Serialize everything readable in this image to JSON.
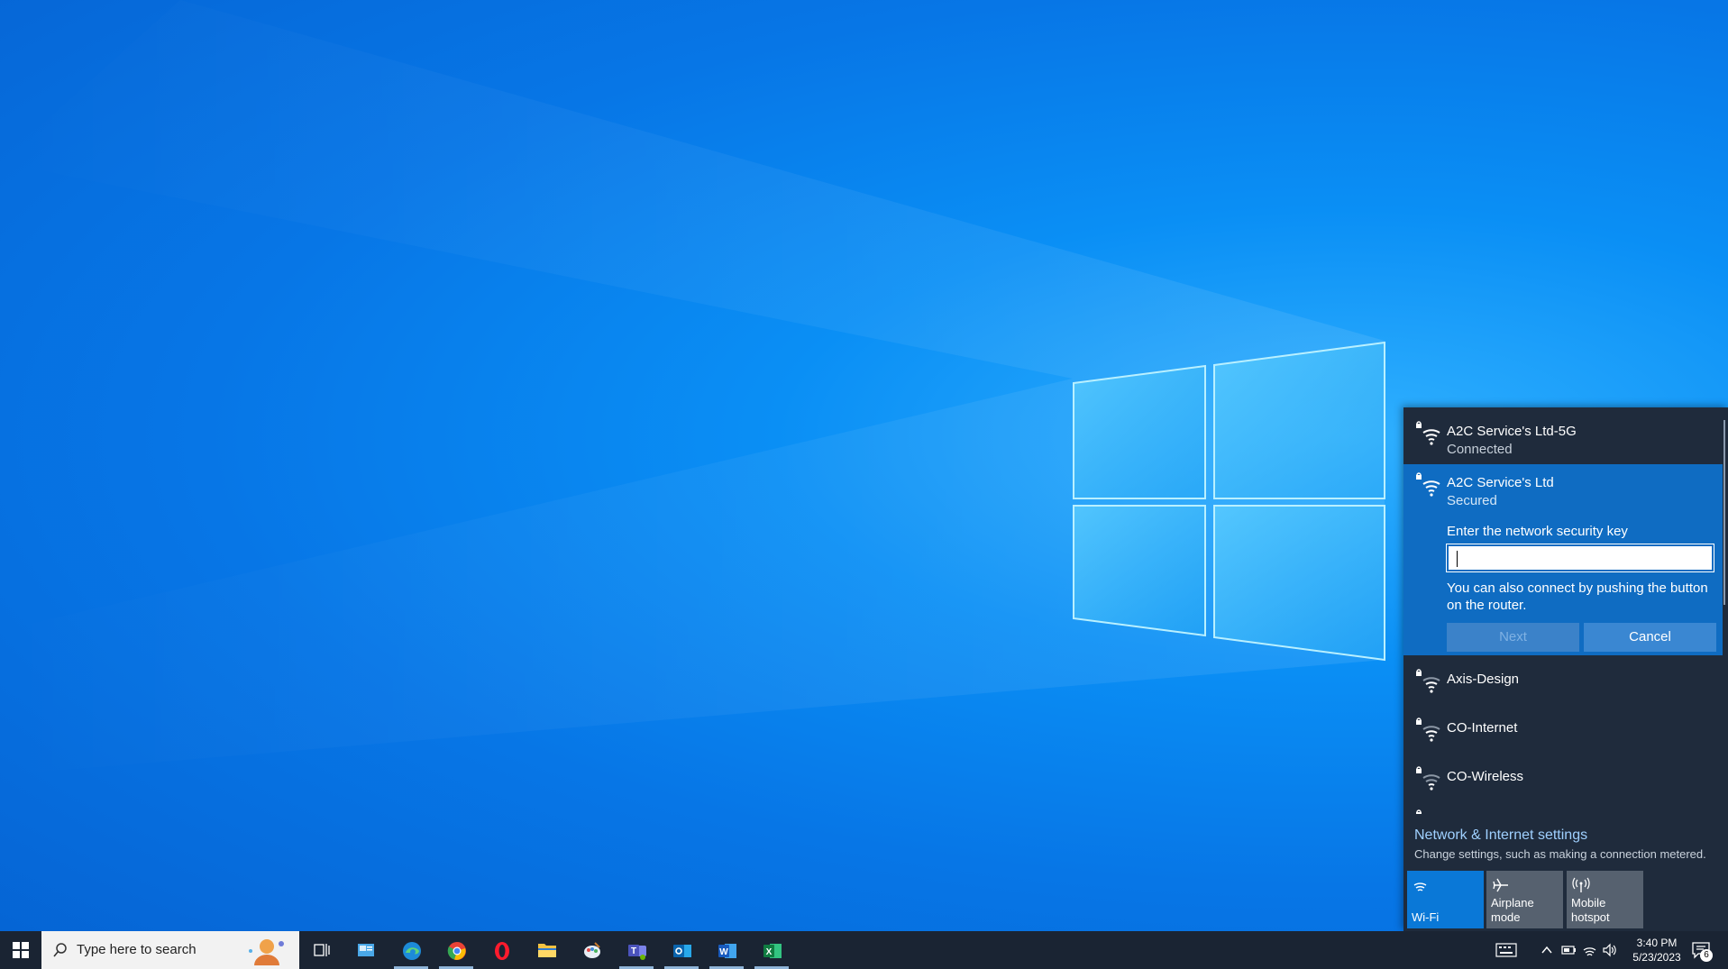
{
  "flyout": {
    "networks_top": [
      {
        "name": "A2C Service's Ltd-5G",
        "status": "Connected"
      }
    ],
    "expanded_network": {
      "name": "A2C Service's Ltd",
      "status": "Secured",
      "key_label": "Enter the network security key",
      "key_value": "",
      "hint": "You can also connect by pushing the button on the router.",
      "next_label": "Next",
      "cancel_label": "Cancel"
    },
    "networks_bottom": [
      {
        "name": "Axis-Design"
      },
      {
        "name": "CO-Internet"
      },
      {
        "name": "CO-Wireless"
      }
    ],
    "settings_title": "Network & Internet settings",
    "settings_subtitle": "Change settings, such as making a connection metered.",
    "quick_actions": [
      {
        "label": "Wi-Fi",
        "icon": "wifi-icon",
        "active": true
      },
      {
        "label": "Airplane mode",
        "icon": "airplane-icon",
        "active": false
      },
      {
        "label": "Mobile hotspot",
        "icon": "hotspot-icon",
        "active": false
      }
    ]
  },
  "taskbar": {
    "search_placeholder": "Type here to search",
    "time": "3:40 PM",
    "date": "5/23/2023",
    "notification_count": "6",
    "apps": [
      "task-view",
      "news",
      "edge",
      "chrome",
      "opera",
      "file-explorer",
      "paint",
      "teams",
      "outlook",
      "word",
      "excel"
    ]
  },
  "colors": {
    "accent": "#0a78d7",
    "flyout_bg": "#1f2b3c",
    "taskbar_bg": "#1a2433",
    "link": "#9fd0ff"
  }
}
